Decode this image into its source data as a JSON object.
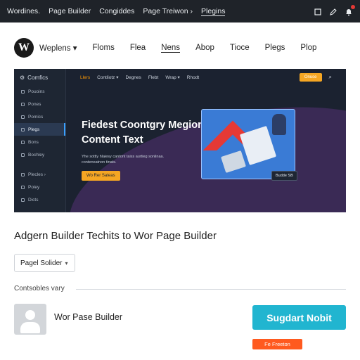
{
  "topbar": {
    "items": [
      "Wordines.",
      "Page Builder",
      "Congiddes",
      "Page Treiwon ›",
      "Plegins"
    ],
    "icons": [
      "square-icon",
      "pencil-icon",
      "bell-icon"
    ],
    "notification_color": "#e53935"
  },
  "header": {
    "logo_letter": "W",
    "nav": [
      "Weplens ▾",
      "Floms",
      "Flea",
      "Nens",
      "Abop",
      "Tioce",
      "Plegs",
      "Plop"
    ]
  },
  "preview": {
    "sidebar_title": "Comfics",
    "sidebar_items": [
      "Pouoins",
      "Pones",
      "Pomics",
      "Plegs",
      "Bons",
      "Bochley"
    ],
    "sidebar_items_lower": [
      "Plecles ›",
      "Poley",
      "Dicts"
    ],
    "topnav": [
      "Llers",
      "Contliotz ▾",
      "Degnes",
      "Flebt",
      "Wrap ▾",
      "Rhodt"
    ],
    "topnav_button": "Onuse",
    "headline": "Fiedest Coontgry Megion Content Text",
    "subtext": "Yhe sottly hlaiesy cantont taiss aurtieg sonlinaa. contenoatnon tinats.",
    "cta": "Wo Rer Sateas",
    "image_badge": "Budde SB",
    "accent": "#f5a623",
    "panel_bg": "#1b2230"
  },
  "main": {
    "headline": "Adgern Builder Techits to Wor Page Builder",
    "select_value": "Pagel Solider",
    "section_label": "Contsobles vary",
    "user_name": "Wor Pase Builder",
    "primary_button": "Sugdart Nobit",
    "primary_color": "#21b5d0",
    "small_button": "Fe Freeton",
    "small_button_color": "#ff5a1f"
  }
}
